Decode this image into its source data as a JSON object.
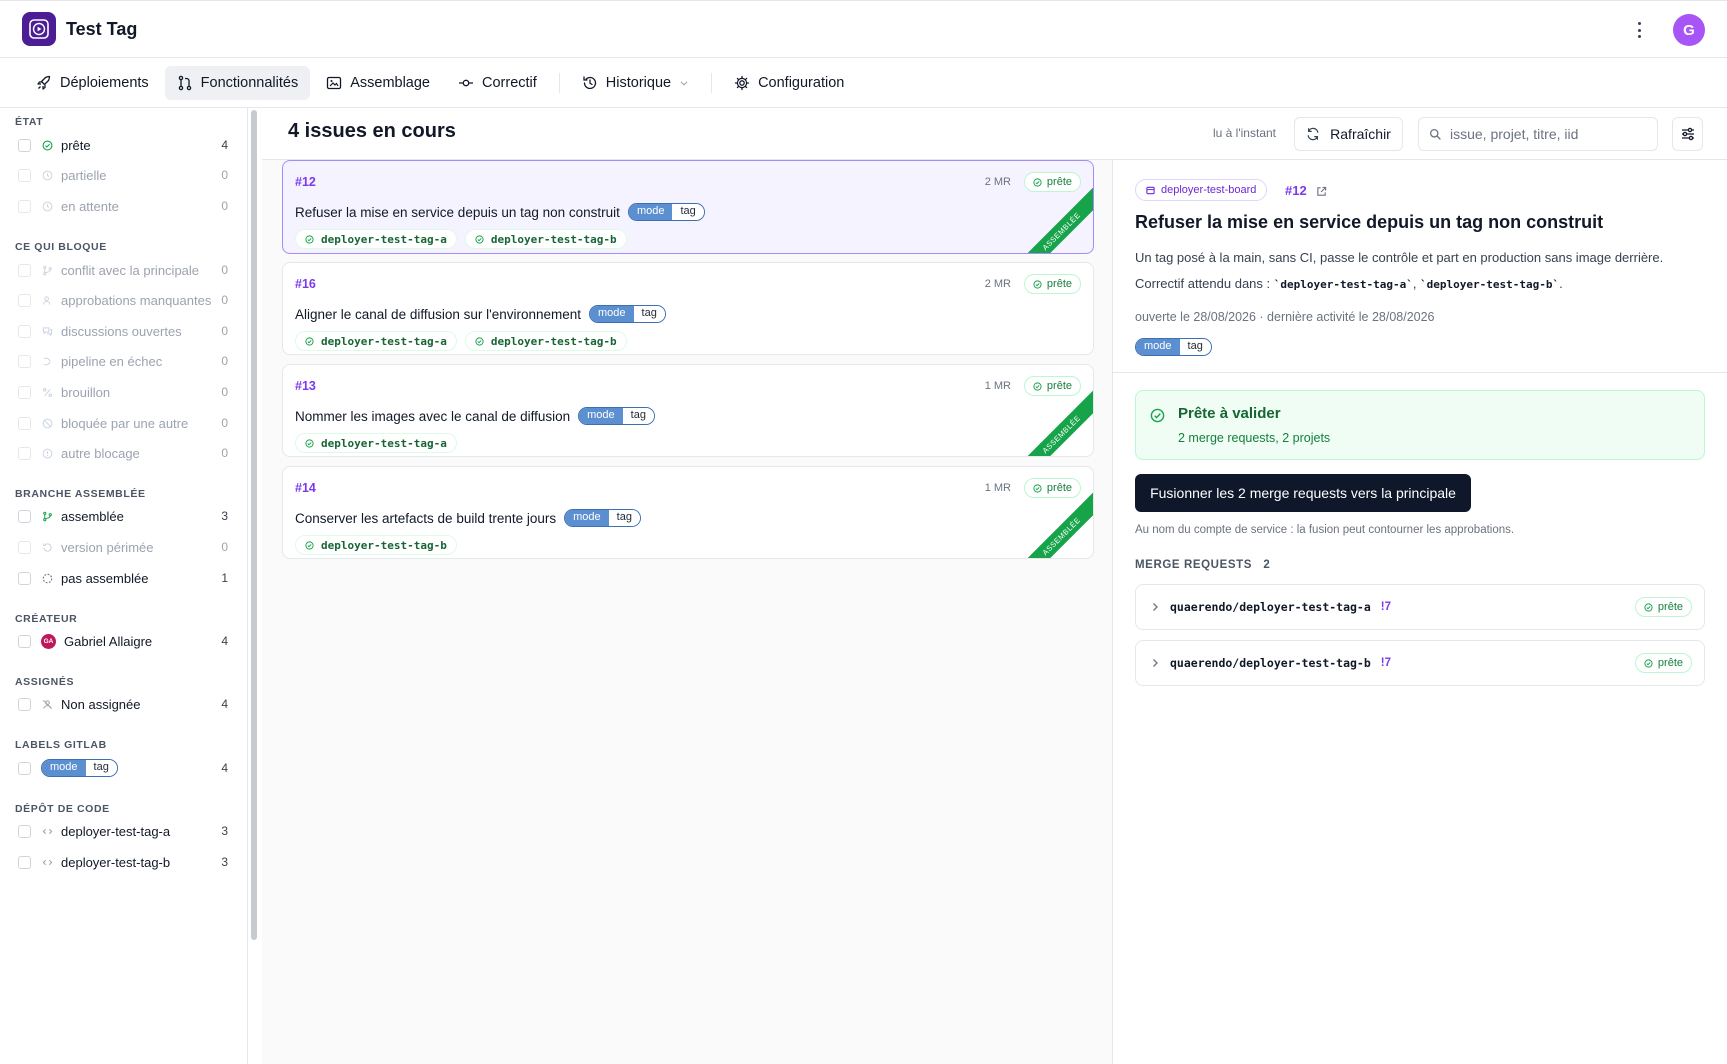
{
  "app": {
    "title": "Test Tag",
    "avatar_letter": "G"
  },
  "nav": {
    "items": [
      {
        "label": "Déploiements",
        "icon": "rocket-icon"
      },
      {
        "label": "Fonctionnalités",
        "icon": "git-pull-request-icon",
        "active": true
      },
      {
        "label": "Assemblage",
        "icon": "image-frame-icon"
      },
      {
        "label": "Correctif",
        "icon": "commit-icon"
      },
      {
        "label": "Historique",
        "icon": "history-icon",
        "dropdown": true
      },
      {
        "label": "Configuration",
        "icon": "gear-icon"
      }
    ]
  },
  "sidebar": {
    "groups": [
      {
        "heading": "ÉTAT",
        "items": [
          {
            "label": "prête",
            "count": "4",
            "icon": "check-circle-icon",
            "dim": false
          },
          {
            "label": "partielle",
            "count": "0",
            "icon": "clock-icon",
            "dim": true
          },
          {
            "label": "en attente",
            "count": "0",
            "icon": "clock-icon",
            "dim": true
          }
        ]
      },
      {
        "heading": "CE QUI BLOQUE",
        "items": [
          {
            "label": "conflit avec la principale",
            "count": "0",
            "icon": "branch-icon",
            "dim": true
          },
          {
            "label": "approbations manquantes",
            "count": "0",
            "icon": "user-icon",
            "dim": true
          },
          {
            "label": "discussions ouvertes",
            "count": "0",
            "icon": "chat-icon",
            "dim": true
          },
          {
            "label": "pipeline en échec",
            "count": "0",
            "icon": "pipeline-icon",
            "dim": true
          },
          {
            "label": "brouillon",
            "count": "0",
            "icon": "draft-icon",
            "dim": true
          },
          {
            "label": "bloquée par une autre",
            "count": "0",
            "icon": "block-icon",
            "dim": true
          },
          {
            "label": "autre blocage",
            "count": "0",
            "icon": "info-icon",
            "dim": true
          }
        ]
      },
      {
        "heading": "BRANCHE ASSEMBLÉE",
        "items": [
          {
            "label": "assemblée",
            "count": "3",
            "icon": "branch-icon",
            "dim": false
          },
          {
            "label": "version périmée",
            "count": "0",
            "icon": "history-icon",
            "dim": true
          },
          {
            "label": "pas assemblée",
            "count": "1",
            "icon": "dashed-circle-icon",
            "dim": false
          }
        ]
      },
      {
        "heading": "CRÉATEUR",
        "items": [
          {
            "label": "Gabriel Allaigre",
            "count": "4",
            "icon": "avatar-icon",
            "initials": "GA",
            "dim": false
          }
        ]
      },
      {
        "heading": "ASSIGNÉS",
        "items": [
          {
            "label": "Non assignée",
            "count": "4",
            "icon": "unassigned-icon",
            "dim": false
          }
        ]
      },
      {
        "heading": "LABELS GITLAB",
        "items": [
          {
            "label_key": "mode",
            "label_val": "tag",
            "count": "4",
            "icon": "label-pill",
            "dim": false
          }
        ]
      },
      {
        "heading": "DÉPÔT DE CODE",
        "items": [
          {
            "label": "deployer-test-tag-a",
            "count": "3",
            "icon": "code-icon",
            "dim": false
          },
          {
            "label": "deployer-test-tag-b",
            "count": "3",
            "icon": "code-icon",
            "dim": false
          }
        ]
      }
    ]
  },
  "list": {
    "title": "4 issues en cours",
    "updated": "lu à l'instant",
    "refresh_label": "Rafraîchir",
    "search_placeholder": "issue, projet, titre, iid"
  },
  "issues": [
    {
      "num": "#12",
      "mr": "2 MR",
      "status": "prête",
      "title": "Refuser la mise en service depuis un tag non construit",
      "label_key": "mode",
      "label_val": "tag",
      "repos": [
        "deployer-test-tag-a",
        "deployer-test-tag-b"
      ],
      "assembled": "ASSEMBLÉE",
      "selected": true
    },
    {
      "num": "#16",
      "mr": "2 MR",
      "status": "prête",
      "title": "Aligner le canal de diffusion sur l'environnement",
      "label_key": "mode",
      "label_val": "tag",
      "repos": [
        "deployer-test-tag-a",
        "deployer-test-tag-b"
      ],
      "assembled": "",
      "selected": false
    },
    {
      "num": "#13",
      "mr": "1 MR",
      "status": "prête",
      "title": "Nommer les images avec le canal de diffusion",
      "label_key": "mode",
      "label_val": "tag",
      "repos": [
        "deployer-test-tag-a"
      ],
      "assembled": "ASSEMBLÉE",
      "selected": false
    },
    {
      "num": "#14",
      "mr": "1 MR",
      "status": "prête",
      "title": "Conserver les artefacts de build trente jours",
      "label_key": "mode",
      "label_val": "tag",
      "repos": [
        "deployer-test-tag-b"
      ],
      "assembled": "ASSEMBLÉE",
      "selected": false
    }
  ],
  "detail": {
    "board": "deployer-test-board",
    "num": "#12",
    "title": "Refuser la mise en service depuis un tag non construit",
    "description": "Un tag posé à la main, sans CI, passe le contrôle et part en production sans image derrière.",
    "fix_prefix": "Correctif attendu dans : ",
    "fix_a": "`deployer-test-tag-a`",
    "fix_sep": ", ",
    "fix_b": "`deployer-test-tag-b`",
    "fix_end": ".",
    "dates": "ouverte le 28/08/2026 · dernière activité le 28/08/2026",
    "label_key": "mode",
    "label_val": "tag",
    "ready_title": "Prête à valider",
    "ready_sub": "2 merge requests, 2 projets",
    "merge_button": "Fusionner les 2 merge requests vers la principale",
    "service_note": "Au nom du compte de service : la fusion peut contourner les approbations.",
    "mr_heading": "MERGE REQUESTS",
    "mr_count": "2",
    "mrs": [
      {
        "path": "quaerendo/deployer-test-tag-a",
        "iid": "!7",
        "status": "prête"
      },
      {
        "path": "quaerendo/deployer-test-tag-b",
        "iid": "!7",
        "status": "prête"
      }
    ]
  },
  "colors": {
    "accent": "#7c3aed",
    "ready": "#15803d",
    "ribbon": "#16a34a",
    "label_key_bg": "#5b8fd0",
    "merge_button": "#0f172a"
  }
}
